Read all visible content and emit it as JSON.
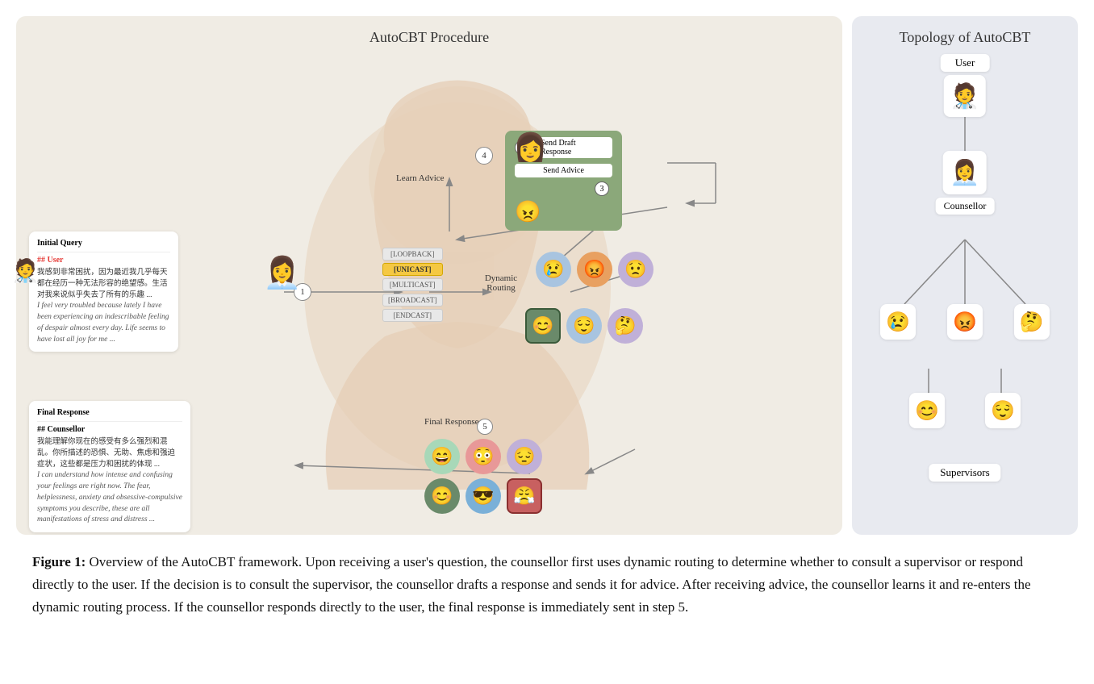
{
  "procedure": {
    "title": "AutoCBT Procedure",
    "steps": {
      "s1": "1",
      "s2": "2",
      "s3": "3",
      "s4": "4",
      "s5": "5"
    },
    "labels": {
      "learn_advice": "Learn Advice",
      "send_draft": "Send Draft Response",
      "send_advice": "Send Advice",
      "dynamic_routing": "Dynamic Routing",
      "final_response": "Final Response",
      "initial_query": "Initial Query"
    },
    "routing_tags": [
      "[LOOPBACK]",
      "[UNICAST]",
      "[MULTICAST]",
      "[BROADCAST]",
      "[ENDCAST]"
    ],
    "initial_query": {
      "title": "Initial Query",
      "subtitle": "## User",
      "chinese": "我感到非常困扰，因为最近我几乎每天都在经历一种无法形容的绝望感。生活对我来说似乎失去了所有的乐趣 ...",
      "english": "I feel very troubled because lately I have been experiencing an indescribable feeling of despair almost every day. Life seems to have lost all joy for me ..."
    },
    "final_response": {
      "title": "Final Response",
      "subtitle": "## Counsellor",
      "chinese": "我能理解你现在的感受有多么强烈和混乱。你所描述的恐惧、无助、焦虑和强迫症状，这些都是压力和困扰的体现 ...",
      "english": "I can understand how intense and confusing your feelings are right now. The fear, helplessness, anxiety and obsessive-compulsive symptoms you describe, these are all manifestations of stress and distress ..."
    }
  },
  "topology": {
    "title": "Topology of AutoCBT",
    "nodes": {
      "user_label": "User",
      "counsellor_label": "Counsellor",
      "supervisors_label": "Supervisors"
    }
  },
  "caption": {
    "label": "Figure 1:",
    "text": " Overview of the AutoCBT framework.  Upon receiving a user's question, the counsellor first uses dynamic routing to determine whether to consult a supervisor or respond directly to the user.  If the decision is to consult the supervisor, the counsellor drafts a response and sends it for advice.  After receiving advice, the counsellor learns it and re-enters the dynamic routing process.  If the counsellor responds directly to the user, the final response is immediately sent in step 5."
  }
}
